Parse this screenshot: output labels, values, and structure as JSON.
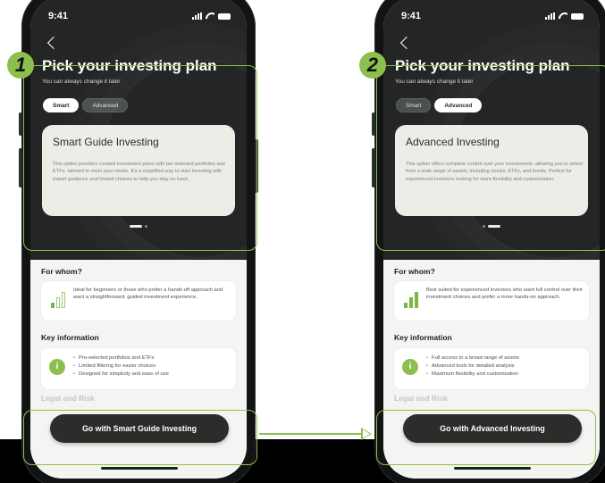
{
  "steps": [
    "1",
    "2"
  ],
  "phones": [
    {
      "status_time": "9:41",
      "title": "Pick your investing plan",
      "subtitle": "You can always change it later",
      "toggle": {
        "smart": "Smart",
        "advanced": "Advanced",
        "selected": "Smart"
      },
      "plan_title": "Smart Guide Investing",
      "plan_desc": "This option provides curated investment plans with per-selected portfolios and ETFs, tailored to meet your needs. It's a simplified way to start investing with expert guidance and limited choices to help you stay on track.",
      "for_whom_heading": "For whom?",
      "for_whom_text": "Ideal for beginners or those who prefer a hands-off approach and want a straightforward, guided investment experience.",
      "key_heading": "Key information",
      "key_items": [
        "Pre-selected portfolios and ETFs",
        "Limited filtering for easier choices",
        "Designed for simplicity and ease of use"
      ],
      "legal_heading": "Legal and Risk",
      "cta": "Go with Smart Guide Investing"
    },
    {
      "status_time": "9:41",
      "title": "Pick your investing plan",
      "subtitle": "You can always change it later",
      "toggle": {
        "smart": "Smart",
        "advanced": "Advanced",
        "selected": "Advanced"
      },
      "plan_title": "Advanced Investing",
      "plan_desc": "This option offers complete control over your investments, allowing you to select from a wide range of assets, including stocks, ETFs, and bonds. Perfect for experienced investors looking for more flexibility and customization.",
      "for_whom_heading": "For whom?",
      "for_whom_text": "Best suited for experienced investors who want full control over their investment choices and prefer a more hands-on approach.",
      "key_heading": "Key information",
      "key_items": [
        "Full access to a broad range of assets",
        "Advanced tools for detailed analysis",
        "Maximum flexibility and customization"
      ],
      "legal_heading": "Legal and Risk",
      "cta": "Go with Advanced Investing"
    }
  ],
  "colors": {
    "accent": "#8cc04e",
    "dark_bg": "#232624",
    "card_bg": "#ecede6",
    "cta_bg": "#2b2d2b"
  }
}
